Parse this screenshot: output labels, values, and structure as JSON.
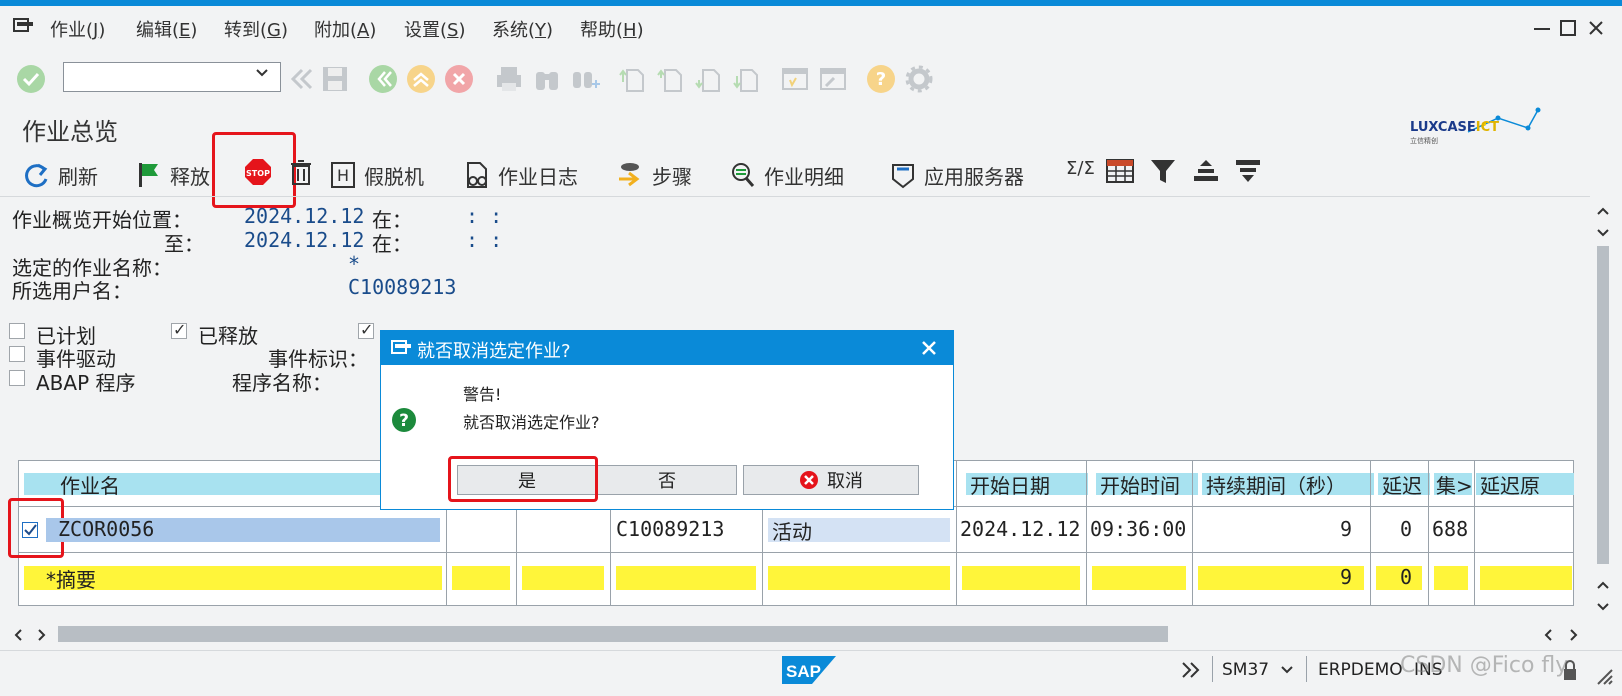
{
  "menu": {
    "items": [
      {
        "label": "作业(",
        "key": "J",
        "end": ")"
      },
      {
        "label": "编辑(",
        "key": "E",
        "end": ")"
      },
      {
        "label": "转到(",
        "key": "G",
        "end": ")"
      },
      {
        "label": "附加(",
        "key": "A",
        "end": ")"
      },
      {
        "label": "设置(",
        "key": "S",
        "end": ")"
      },
      {
        "label": "系统(",
        "key": "Y",
        "end": ")"
      },
      {
        "label": "帮助(",
        "key": "H",
        "end": ")"
      }
    ]
  },
  "page": {
    "title": "作业总览",
    "logo_text": "LUXCASE",
    "logo_accent": "ICT",
    "logo_sub": "立信精创"
  },
  "app_toolbar": {
    "refresh": "刷新",
    "release": "释放",
    "stop_icon_text": "STOP",
    "disconnect": "假脱机",
    "disconnect_icon_letter": "H",
    "job_log": "作业日志",
    "steps": "步骤",
    "job_detail": "作业明细",
    "app_server": "应用服务器",
    "sum_symbol": "Σ/Σ"
  },
  "criteria": {
    "start_label": "作业概览开始位置：",
    "start_date": "2024.12.12",
    "at_label": "在：",
    "time_placeholder": ":   :",
    "to_label": "至：",
    "end_date": "2024.12.12",
    "job_name_label": "选定的作业名称：",
    "job_name_value": "*",
    "user_label": "所选用户名：",
    "user_value": "C10089213"
  },
  "status_filters": {
    "planned": "已计划",
    "released": "已释放",
    "event_driven": "事件驱动",
    "event_id_label": "事件标识：",
    "abap_program": "ABAP 程序",
    "program_name_label": "程序名称："
  },
  "table": {
    "headers": {
      "job_name": "作业名",
      "start_date": "开始日期",
      "start_time": "开始时间",
      "duration": "持续期间（秒）",
      "delay": "延迟",
      "set": "集>",
      "delay_reason": "延迟原"
    },
    "row": {
      "job_name": "ZCOR0056",
      "user": "C10089213",
      "status": "活动",
      "start_date": "2024.12.12",
      "start_time": "09:36:00",
      "duration": "9",
      "delay": "0",
      "set": "688"
    },
    "summary": {
      "label": "*摘要",
      "duration": "9",
      "delay": "0"
    }
  },
  "dialog": {
    "title": "就否取消选定作业?",
    "warning": "警告!",
    "question": "就否取消选定作业?",
    "yes": "是",
    "no": "否",
    "cancel": "取消"
  },
  "statusbar": {
    "sap": "SAP",
    "tcode": "SM37",
    "system": "ERPDEMO",
    "mode": "INS",
    "watermark": "CSDN @Fico fly"
  },
  "colors": {
    "accent": "#0a8ad8",
    "header_bg": "#a8e2f0",
    "highlight": "#fff53a",
    "annotation": "#e5141b"
  }
}
